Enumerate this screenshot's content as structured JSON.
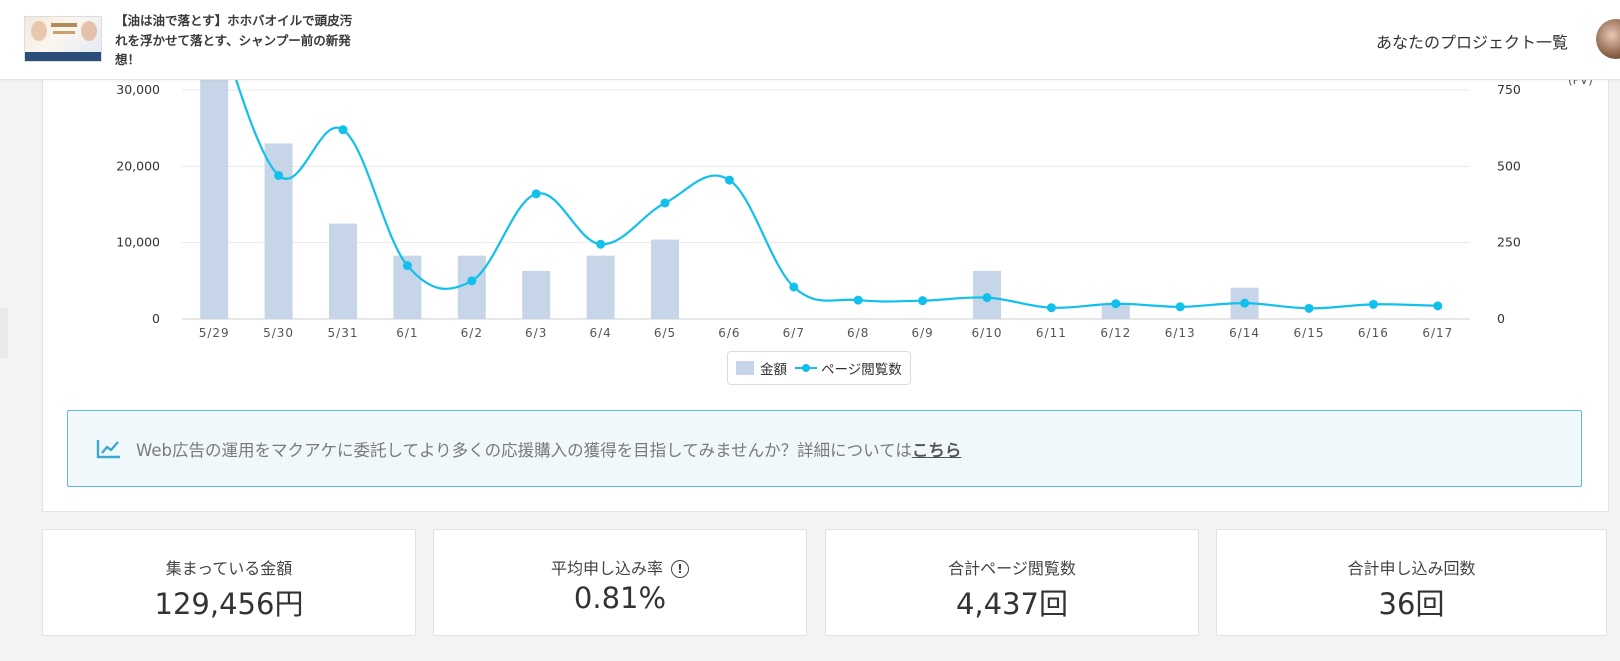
{
  "header": {
    "project_title": "【油は油で落とす】ホホバオイルで頭皮汚れを浮かせて落とす、シャンプー前の新発想！",
    "nav_link": "あなたのプロジェクト一覧"
  },
  "chart_data": {
    "type": "bar+line",
    "categories": [
      "5/29",
      "5/30",
      "5/31",
      "6/1",
      "6/2",
      "6/3",
      "6/4",
      "6/5",
      "6/6",
      "6/7",
      "6/8",
      "6/9",
      "6/10",
      "6/11",
      "6/12",
      "6/13",
      "6/14",
      "6/15",
      "6/16",
      "6/17"
    ],
    "series": [
      {
        "name": "金額",
        "axis": "left",
        "type": "bar",
        "color": "#c7d5e8",
        "values": [
          34000,
          23000,
          12500,
          8300,
          8300,
          6300,
          8300,
          10400,
          0,
          0,
          0,
          0,
          6300,
          0,
          2000,
          0,
          4100,
          0,
          0,
          0
        ]
      },
      {
        "name": "ページ閲覧数",
        "axis": "right",
        "type": "line",
        "color": "#12c0ec",
        "values": [
          1000,
          470,
          620,
          175,
          125,
          410,
          245,
          380,
          455,
          105,
          62,
          60,
          70,
          37,
          50,
          40,
          52,
          35,
          48,
          43
        ]
      }
    ],
    "y_left": {
      "ticks": [
        "0",
        "10,000",
        "20,000",
        "30,000"
      ],
      "tick_values": [
        0,
        10000,
        20000,
        30000
      ],
      "range": [
        0,
        30000
      ]
    },
    "y_right": {
      "ticks": [
        "0",
        "250",
        "500",
        "750"
      ],
      "tick_values": [
        0,
        250,
        500,
        750
      ],
      "range": [
        0,
        750
      ],
      "unit": "(PV)"
    },
    "legend_placement": "bottom-center",
    "grid": true
  },
  "legend": {
    "bar_label": "金額",
    "line_label": "ページ閲覧数"
  },
  "notice": {
    "text": "Web広告の運用をマクアケに委託してより多くの応援購入の獲得を目指してみませんか？詳細については",
    "link": "こちら"
  },
  "stats": [
    {
      "label": "集まっている金額",
      "value": "129,456円"
    },
    {
      "label": "平均申し込み率",
      "value": "0.81%",
      "info_icon": "!"
    },
    {
      "label": "合計ページ閲覧数",
      "value": "4,437回"
    },
    {
      "label": "合計申し込み回数",
      "value": "36回"
    }
  ]
}
